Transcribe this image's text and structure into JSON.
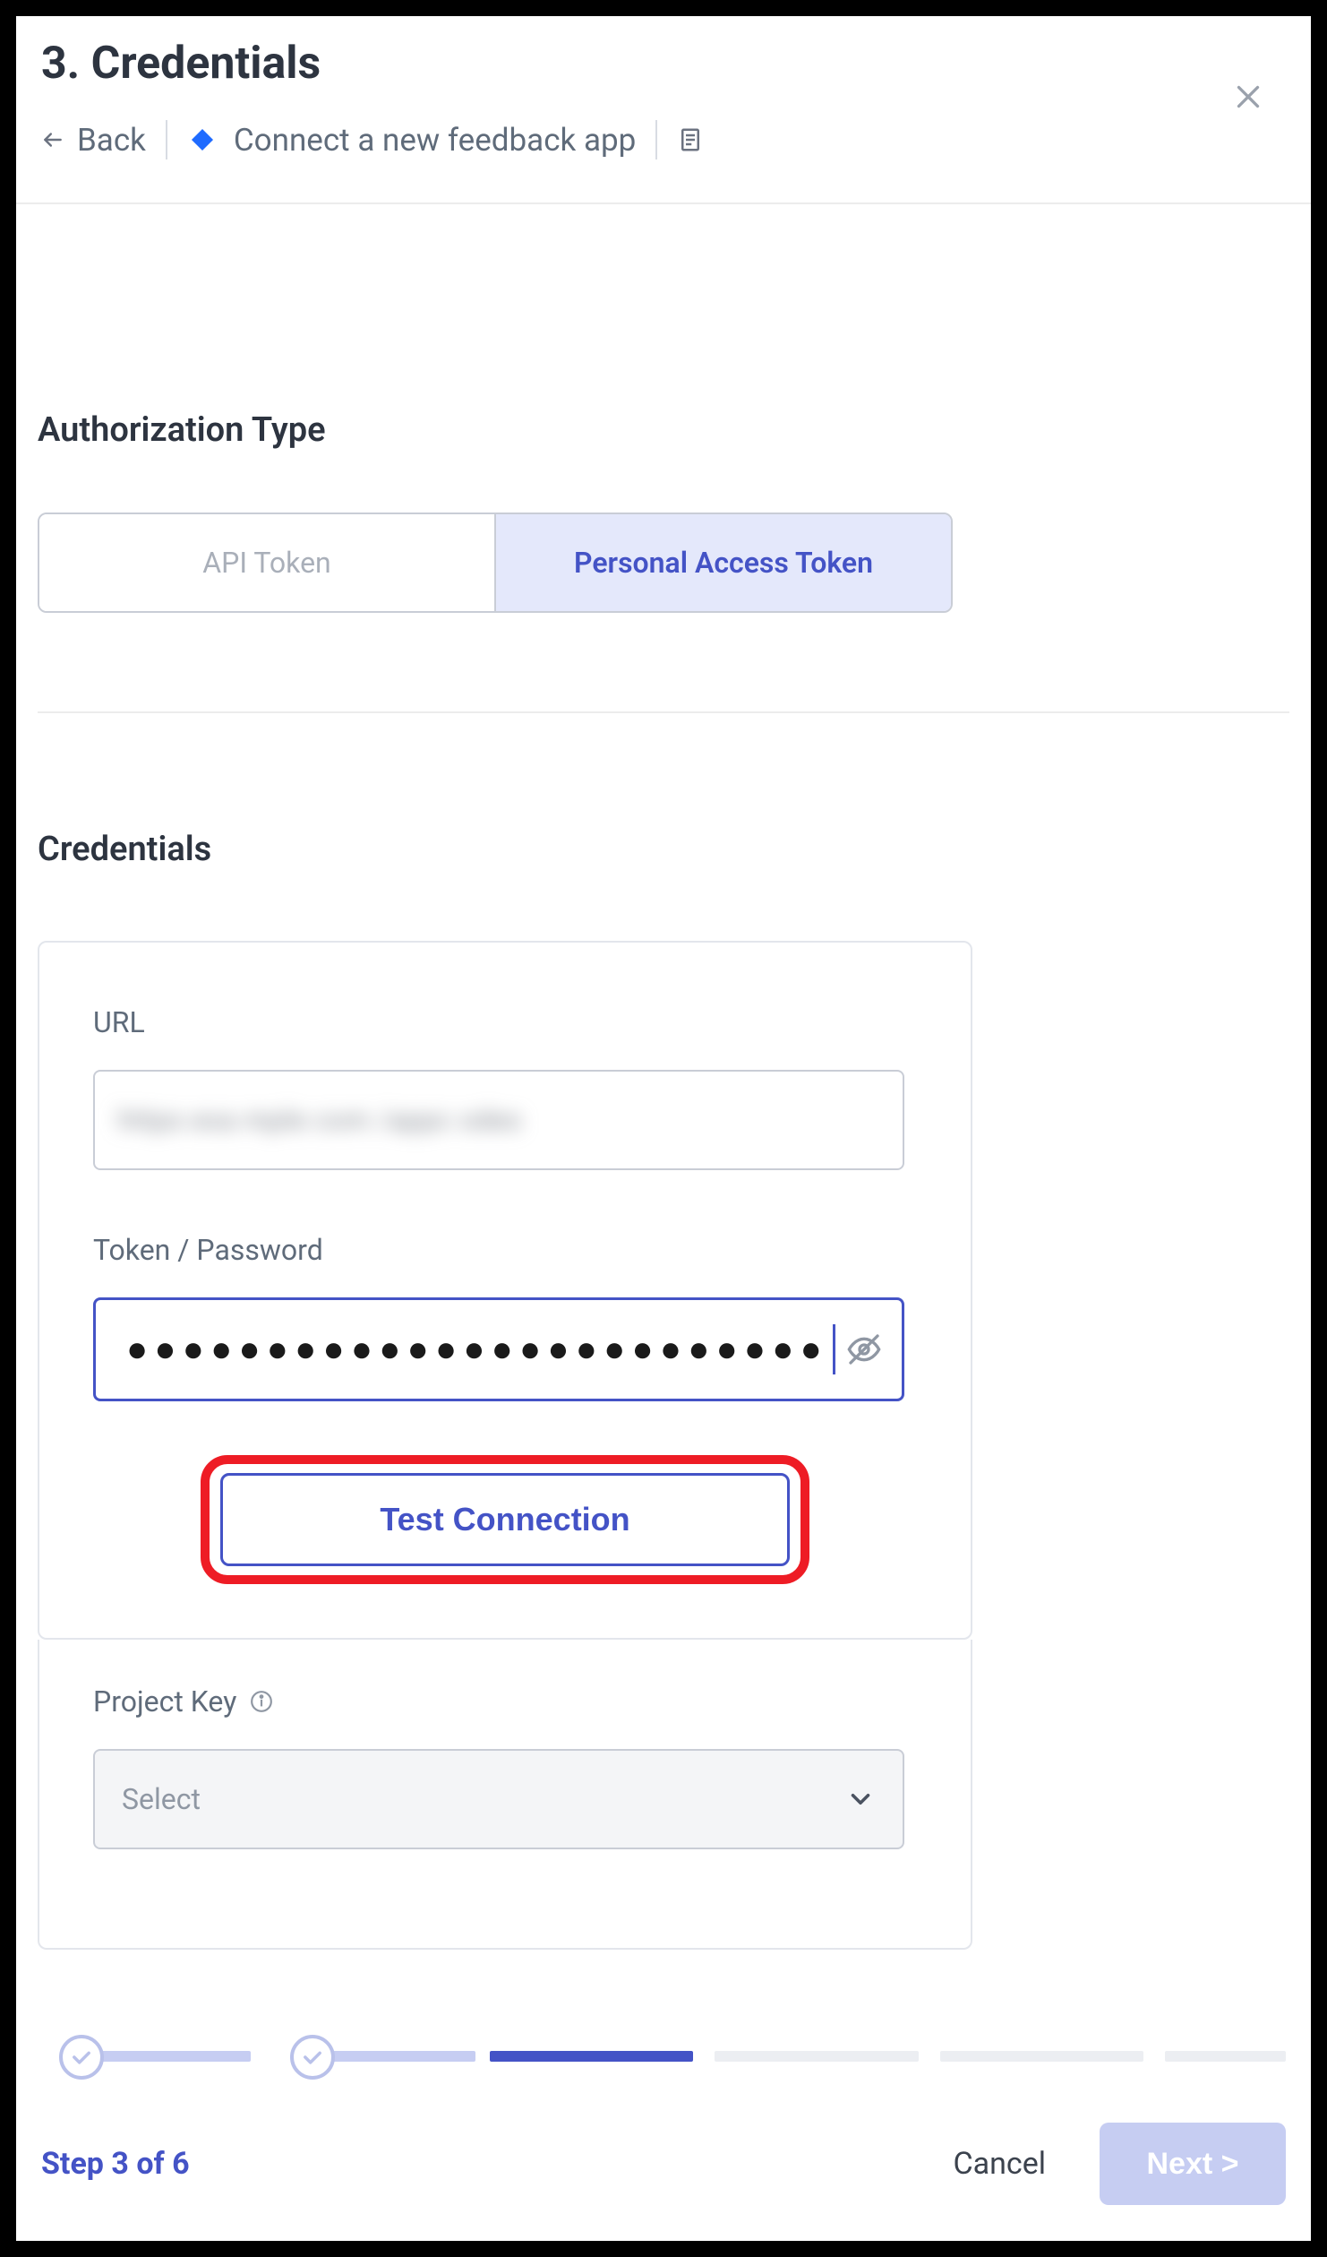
{
  "header": {
    "title": "3. Credentials",
    "back_label": "Back",
    "breadcrumb_text": "Connect a new feedback app"
  },
  "auth": {
    "section_label": "Authorization Type",
    "options": {
      "api_token": "API Token",
      "pat": "Personal Access Token"
    },
    "selected": "pat"
  },
  "credentials": {
    "section_label": "Credentials",
    "url_label": "URL",
    "url_value_obscured": true,
    "token_label": "Token / Password",
    "token_masked": "●●●●●●●●●●●●●●●●●●●●●●●●●●●●●●●●●●●●●●●●●●●",
    "test_button": "Test Connection",
    "project_key_label": "Project Key",
    "project_key_placeholder": "Select"
  },
  "footer": {
    "step_text": "Step 3 of 6",
    "cancel_label": "Cancel",
    "next_label": "Next >",
    "current_step": 3,
    "total_steps": 6,
    "completed_steps": [
      1,
      2
    ]
  }
}
